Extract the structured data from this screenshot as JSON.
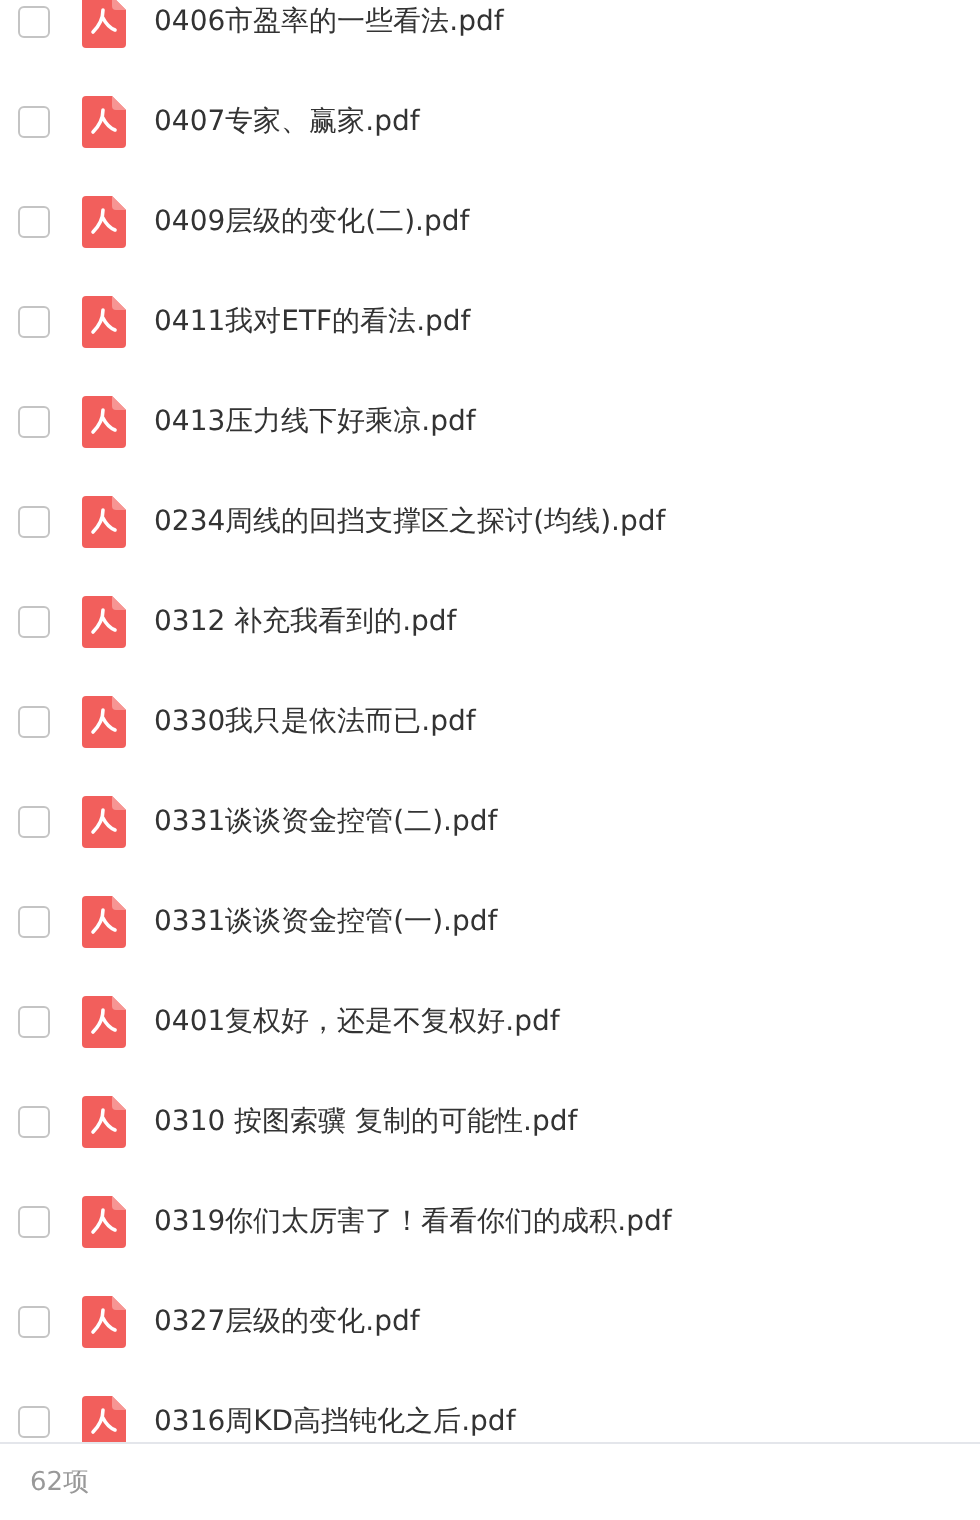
{
  "files": [
    {
      "name": "0406市盈率的一些看法.pdf",
      "checked": false
    },
    {
      "name": "0407专家、赢家.pdf",
      "checked": false
    },
    {
      "name": "0409层级的变化(二).pdf",
      "checked": false
    },
    {
      "name": "0411我对ETF的看法.pdf",
      "checked": false
    },
    {
      "name": "0413压力线下好乘凉.pdf",
      "checked": false
    },
    {
      "name": "0234周线的回挡支撑区之探讨(均线).pdf",
      "checked": false
    },
    {
      "name": "0312 补充我看到的.pdf",
      "checked": false
    },
    {
      "name": "0330我只是依法而已.pdf",
      "checked": false
    },
    {
      "name": "0331谈谈资金控管(二).pdf",
      "checked": false
    },
    {
      "name": "0331谈谈资金控管(一).pdf",
      "checked": false
    },
    {
      "name": "0401复权好，还是不复权好.pdf",
      "checked": false
    },
    {
      "name": "0310 按图索骥 复制的可能性.pdf",
      "checked": false
    },
    {
      "name": "0319你们太厉害了！看看你们的成积.pdf",
      "checked": false
    },
    {
      "name": "0327层级的变化.pdf",
      "checked": false
    },
    {
      "name": "0316周KD高挡钝化之后.pdf",
      "checked": false
    }
  ],
  "footer": {
    "count": "62项"
  }
}
